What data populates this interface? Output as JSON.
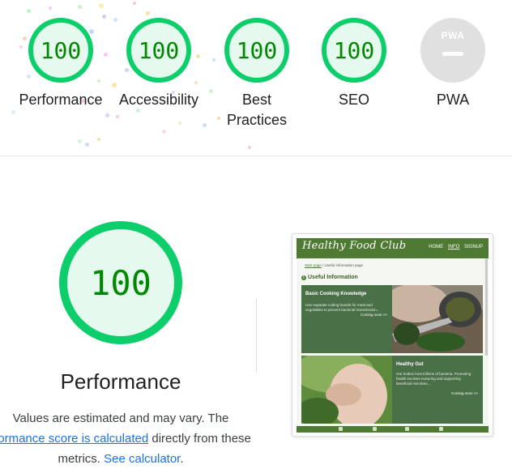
{
  "gauges": [
    {
      "score": "100",
      "label": "Performance"
    },
    {
      "score": "100",
      "label": "Accessibility"
    },
    {
      "score": "100",
      "label": "Best Practices"
    },
    {
      "score": "100",
      "label": "SEO"
    }
  ],
  "pwa": {
    "badge": "PWA",
    "label": "PWA"
  },
  "performance": {
    "score": "100",
    "title": "Performance",
    "note_line1": "Values are estimated and may vary. The",
    "note_link1": "rformance score is calculated",
    "note_line2_tail": " directly from these",
    "note_line3": "metrics. ",
    "note_link2": "See calculator",
    "note_end": "."
  },
  "thumbnail": {
    "logo": "Healthy Food Club",
    "nav": [
      "HOME",
      "INFO",
      "SIGNUP"
    ],
    "breadcrumb_link": "Start page",
    "breadcrumb_current": "/ Useful information page",
    "section_title": "Useful Information",
    "cards": [
      {
        "title": "Basic Cooking Knowledge",
        "body": "Use separate cutting boards for meat and vegetables to prevent bacterial transmission...",
        "more": "Coming soon >>"
      },
      {
        "title": "Healthy Gut",
        "body": "Our bodies host trillions of bacteria. Promoting health involves nurturing and supporting beneficial microbes...",
        "more": "Coming soon >>"
      }
    ]
  },
  "colors": {
    "pass": "#0cce6b",
    "pass_text": "#008800",
    "pass_bg": "#e6f9ee",
    "link": "#1a73e8",
    "brand_green": "#4f7a34"
  }
}
